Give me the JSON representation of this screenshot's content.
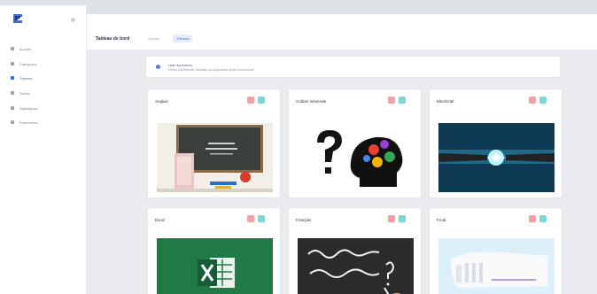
{
  "sidebar": {
    "items": [
      {
        "label": "Accueil"
      },
      {
        "label": "Catégories"
      },
      {
        "label": "Thèmes"
      },
      {
        "label": "Séries"
      },
      {
        "label": "Statistiques"
      },
      {
        "label": "Paramètres"
      }
    ],
    "active_index": 2
  },
  "header": {
    "title": "Tableau de bord",
    "breadcrumb": "Accueil",
    "current": "Thèmes"
  },
  "notice": {
    "line1": "Liste des thèmes",
    "line2": "Gérez vos thèmes, modifiez ou supprimez selon vos besoins"
  },
  "cards": [
    {
      "title": "Anglais"
    },
    {
      "title": "Culture Générale"
    },
    {
      "title": "Electricité"
    },
    {
      "title": "Excel"
    },
    {
      "title": "Français"
    },
    {
      "title": "Froid"
    }
  ],
  "colors": {
    "accent": "#3b6fd4",
    "delete": "#f3a0a6",
    "edit": "#7fd7d5",
    "excel_green": "#1f7a45",
    "chalkboard": "#2b2b2b"
  }
}
